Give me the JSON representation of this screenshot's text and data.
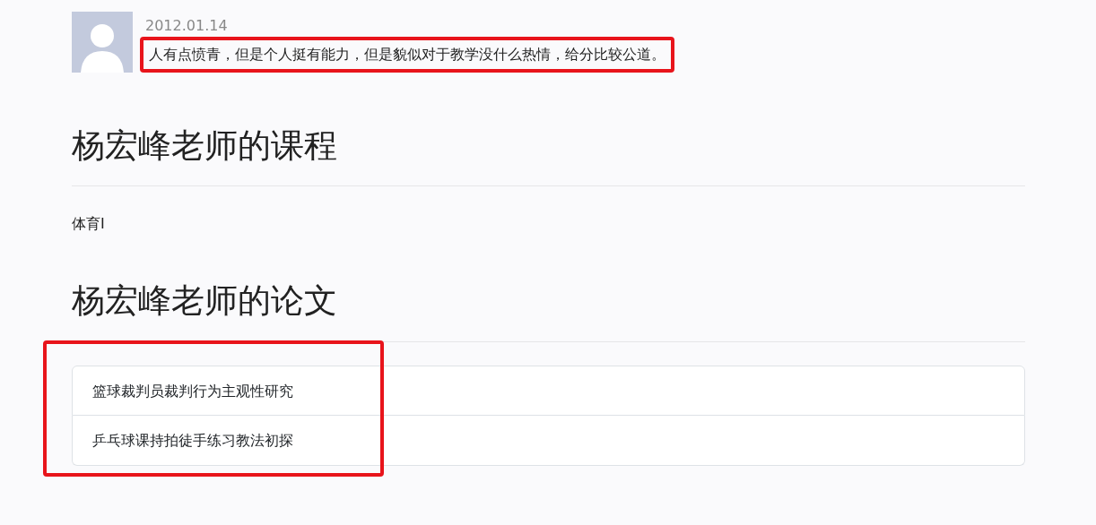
{
  "comment": {
    "date": "2012.01.14",
    "text": "人有点愤青，但是个人挺有能力，但是貌似对于教学没什么热情，给分比较公道。",
    "highlighted": true
  },
  "courses": {
    "heading": "杨宏峰老师的课程",
    "items": [
      "体育I"
    ]
  },
  "papers": {
    "heading": "杨宏峰老师的论文",
    "highlighted": true,
    "items": [
      "篮球裁判员裁判行为主观性研究",
      "乒乓球课持拍徒手练习教法初探"
    ]
  }
}
